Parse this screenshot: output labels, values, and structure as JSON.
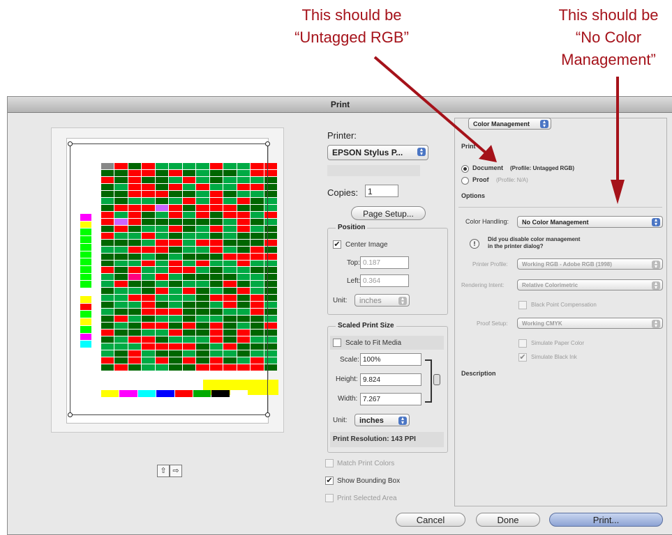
{
  "annotations": {
    "left": [
      "This should be",
      "“Untagged RGB”"
    ],
    "right": [
      "This should be",
      "“No Color",
      "Management”"
    ]
  },
  "dialog": {
    "title": "Print"
  },
  "printer": {
    "label": "Printer:",
    "value": "EPSON Stylus P..."
  },
  "copies": {
    "label": "Copies:",
    "value": "1"
  },
  "page_setup": "Page Setup...",
  "position": {
    "title": "Position",
    "center_image": "Center Image",
    "top_label": "Top:",
    "top_value": "0.187",
    "left_label": "Left:",
    "left_value": "0.364",
    "unit_label": "Unit:",
    "unit_value": "inches"
  },
  "scaled": {
    "title": "Scaled Print Size",
    "scale_to_fit": "Scale to Fit Media",
    "scale_label": "Scale:",
    "scale_value": "100%",
    "height_label": "Height:",
    "height_value": "9.824",
    "width_label": "Width:",
    "width_value": "7.267",
    "unit_label": "Unit:",
    "unit_value": "inches",
    "resolution": "Print Resolution: 143 PPI"
  },
  "bottom_options": {
    "match_print_colors": "Match Print Colors",
    "show_bounding_box": "Show Bounding Box",
    "print_selected_area": "Print Selected Area"
  },
  "color_management": {
    "section_popup": "Color Management",
    "print_heading": "Print",
    "document_label": "Document",
    "document_profile": "(Profile: Untagged RGB)",
    "proof_label": "Proof",
    "proof_profile": "(Profile: N/A)",
    "options_heading": "Options",
    "color_handling_label": "Color Handling:",
    "color_handling_value": "No Color Management",
    "warning_line1": "Did you disable color management",
    "warning_line2": "in the printer dialog?",
    "printer_profile_label": "Printer Profile:",
    "printer_profile_value": "Working RGB - Adobe RGB (1998)",
    "rendering_intent_label": "Rendering Intent:",
    "rendering_intent_value": "Relative Colorimetric",
    "black_point": "Black Point Compensation",
    "proof_setup_label": "Proof Setup:",
    "proof_setup_value": "Working CMYK",
    "simulate_paper": "Simulate Paper Color",
    "simulate_ink": "Simulate Black Ink",
    "description_heading": "Description"
  },
  "buttons": {
    "cancel": "Cancel",
    "done": "Done",
    "print": "Print..."
  },
  "orientation": {
    "portrait": "⇧",
    "landscape": "⇨"
  },
  "colors": {
    "annotation_red": "#a5121a",
    "print_button": "#8da3d4"
  }
}
